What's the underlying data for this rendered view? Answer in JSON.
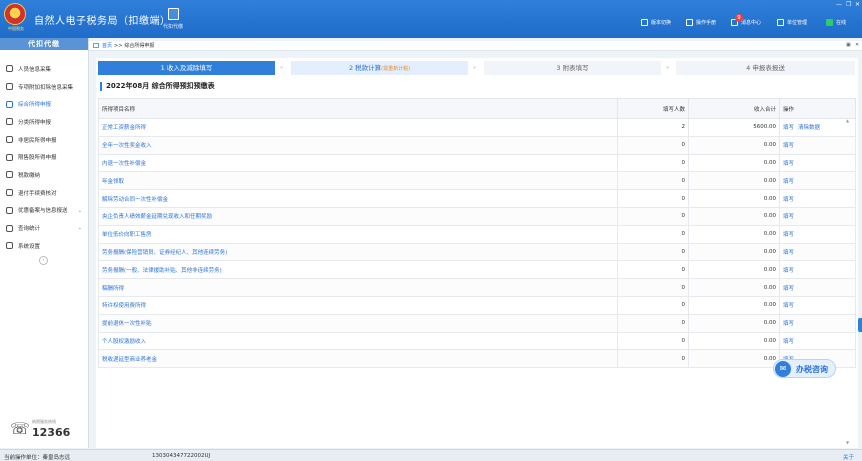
{
  "header": {
    "title": "自然人电子税务局（扣缴端）",
    "emblem_caption": "中国税务",
    "agent_button": "代扣代缴",
    "nav": [
      {
        "label": "版本切换",
        "icon": "version-switch-icon"
      },
      {
        "label": "操作手册",
        "icon": "manual-icon"
      },
      {
        "label": "消息中心",
        "icon": "message-icon",
        "badge": "9"
      },
      {
        "label": "单位管理",
        "icon": "unit-icon"
      },
      {
        "label": "在线",
        "icon": "online-icon"
      }
    ],
    "window_controls": {
      "minimize": "—",
      "restore": "❐",
      "close": "✕"
    }
  },
  "sidebar": {
    "header": "代扣代缴",
    "items": [
      {
        "label": "人员信息采集",
        "icon": "person-icon"
      },
      {
        "label": "专项附加扣除信息采集",
        "icon": "list-icon"
      },
      {
        "label": "综合所得申报",
        "icon": "layers-icon",
        "active": true
      },
      {
        "label": "分类所得申报",
        "icon": "pie-icon"
      },
      {
        "label": "非居民所得申报",
        "icon": "user-icon"
      },
      {
        "label": "限售股所得申报",
        "icon": "chart-icon"
      },
      {
        "label": "税款缴纳",
        "icon": "folder-icon"
      },
      {
        "label": "退付手续费核对",
        "icon": "doc-icon"
      },
      {
        "label": "优惠备案与信息报送",
        "icon": "file-icon",
        "chevron": "⌄"
      },
      {
        "label": "查询统计",
        "icon": "search-icon",
        "chevron": "⌄"
      },
      {
        "label": "系统设置",
        "icon": "gear-icon"
      }
    ],
    "collapse": "‹",
    "hotline_caption": "纳税服务热线",
    "hotline_number": "12366"
  },
  "breadcrumb": {
    "home": "首页",
    "sep": ">>",
    "current": "综合所得申报",
    "ctl_restore": "▣",
    "ctl_close": "✕"
  },
  "steps": [
    {
      "label": "1 收入及减除填写",
      "state": "active"
    },
    {
      "label": "2 税款计算",
      "sub": "(需重新计税)",
      "state": "current"
    },
    {
      "label": "3 附表填写",
      "state": "normal"
    },
    {
      "label": "4 申报表报送",
      "state": "normal"
    }
  ],
  "step_separator": "»",
  "form_title": "2022年08月  综合所得预扣预缴表",
  "table": {
    "columns": [
      "所得项目名称",
      "填写人数",
      "收入合计",
      "操作"
    ],
    "rows": [
      {
        "name": "正常工资薪金所得",
        "count": "2",
        "income": "5600.00",
        "ops": [
          "填写",
          "清除数据"
        ]
      },
      {
        "name": "全年一次性奖金收入",
        "count": "0",
        "income": "0.00",
        "ops": [
          "填写"
        ]
      },
      {
        "name": "内退一次性补偿金",
        "count": "0",
        "income": "0.00",
        "ops": [
          "填写"
        ]
      },
      {
        "name": "年金领取",
        "count": "0",
        "income": "0.00",
        "ops": [
          "填写"
        ]
      },
      {
        "name": "解除劳动合同一次性补偿金",
        "count": "0",
        "income": "0.00",
        "ops": [
          "填写"
        ]
      },
      {
        "name": "央企负责人绩效薪金延期兑现收入和任期奖励",
        "count": "0",
        "income": "0.00",
        "ops": [
          "填写"
        ]
      },
      {
        "name": "单位低价向职工售房",
        "count": "0",
        "income": "0.00",
        "ops": [
          "填写"
        ]
      },
      {
        "name": "劳务报酬(保险营销员、证券经纪人、其他连续劳务)",
        "count": "0",
        "income": "0.00",
        "ops": [
          "填写"
        ]
      },
      {
        "name": "劳务报酬(一般、法律援助补贴、其他非连续劳务)",
        "count": "0",
        "income": "0.00",
        "ops": [
          "填写"
        ]
      },
      {
        "name": "稿酬所得",
        "count": "0",
        "income": "0.00",
        "ops": [
          "填写"
        ]
      },
      {
        "name": "特许权使用费所得",
        "count": "0",
        "income": "0.00",
        "ops": [
          "填写"
        ]
      },
      {
        "name": "提前退休一次性补贴",
        "count": "0",
        "income": "0.00",
        "ops": [
          "填写"
        ]
      },
      {
        "name": "个人股权激励收入",
        "count": "0",
        "income": "0.00",
        "ops": [
          "填写"
        ]
      },
      {
        "name": "税收递延型商业养老金",
        "count": "0",
        "income": "0.00",
        "ops": [
          "填写"
        ]
      }
    ]
  },
  "consult": {
    "label": "办税咨询"
  },
  "status": {
    "unit_label": "当前操作单位：秦皇岛志远",
    "tax_id": "130304347722002UJ",
    "about": "关于"
  }
}
